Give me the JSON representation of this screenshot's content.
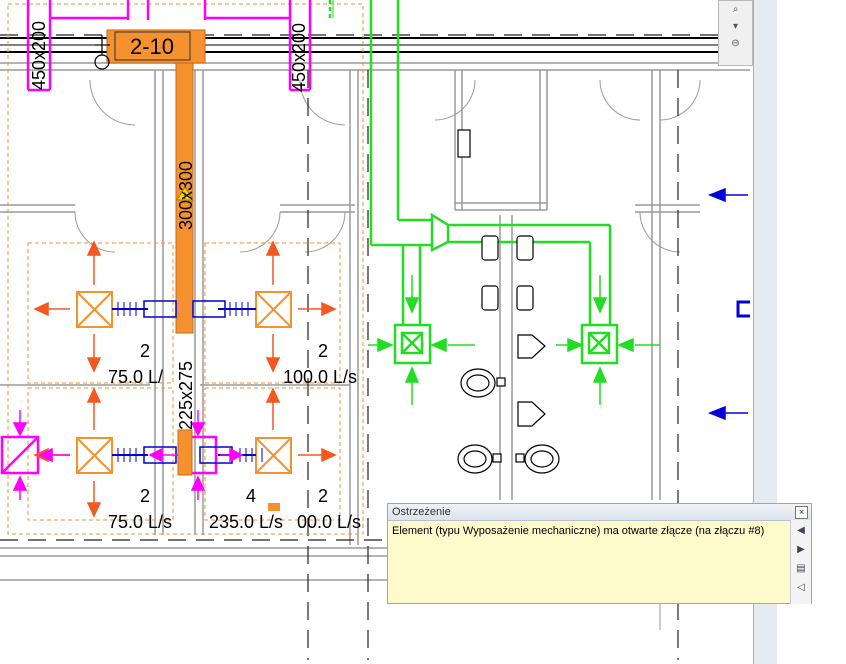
{
  "drawing": {
    "duct_labels": {
      "left_vertical": "450x200",
      "right_vertical": "450x200",
      "main_trunk": "300x300",
      "lower_trunk": "225x275"
    },
    "room_tag": "2-10",
    "terminals": [
      {
        "count": "2",
        "flow": "75.0 L/"
      },
      {
        "count": "2",
        "flow": "100.0 L/s"
      },
      {
        "count": "2",
        "flow": "75.0 L/s"
      },
      {
        "count": "4",
        "flow": "235.0 L/s"
      },
      {
        "count": "2",
        "flow": "00.0 L/s"
      }
    ],
    "colors": {
      "supply_duct": "#f5922f",
      "exhaust_duct": "#22dd22",
      "return_duct": "#ff00ff",
      "flex_duct": "#0000cc",
      "terminal_arrow": "#f5581f",
      "annotation_arrow": "#0000dd"
    }
  },
  "warning": {
    "title": "Ostrzeżenie",
    "message": "Element (typu Wyposażenie mechaniczne) ma otwarte złącze (na złączu #8)",
    "close_icon": "close-icon",
    "buttons": [
      "previous-icon",
      "next-icon",
      "show-icon",
      "speaker-icon"
    ],
    "close_glyph": "×",
    "button_glyphs": [
      "◀",
      "▶",
      "▤",
      "◁"
    ]
  },
  "navbar": {
    "buttons": [
      "zoom-icon",
      "chevron-icon",
      "settings-icon"
    ],
    "glyphs": [
      "⌕",
      "▾",
      "⊖"
    ]
  }
}
